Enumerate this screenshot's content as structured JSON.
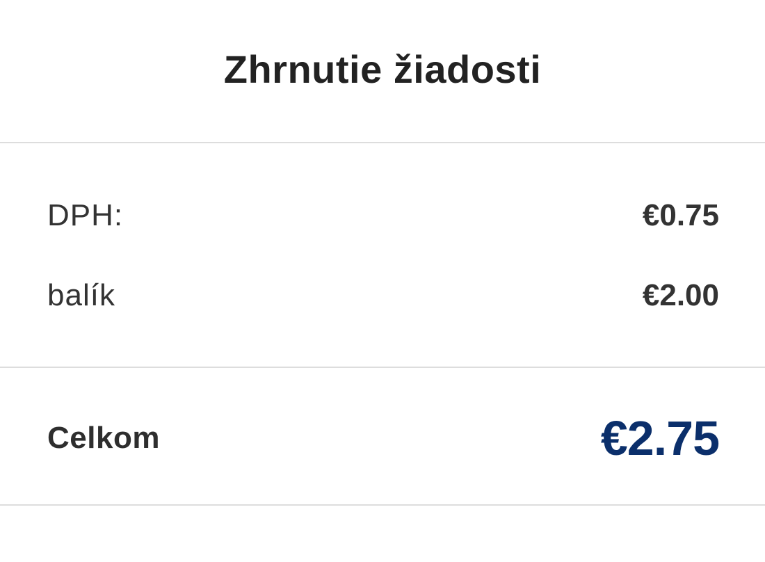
{
  "summary": {
    "title": "Zhrnutie žiadosti",
    "lines": [
      {
        "label": "DPH:",
        "amount": "€0.75"
      },
      {
        "label": "balík",
        "amount": "€2.00"
      }
    ],
    "total": {
      "label": "Celkom",
      "amount": "€2.75"
    }
  },
  "colors": {
    "text": "#333333",
    "divider": "#dddddd",
    "total_accent": "#0b2f6b"
  }
}
